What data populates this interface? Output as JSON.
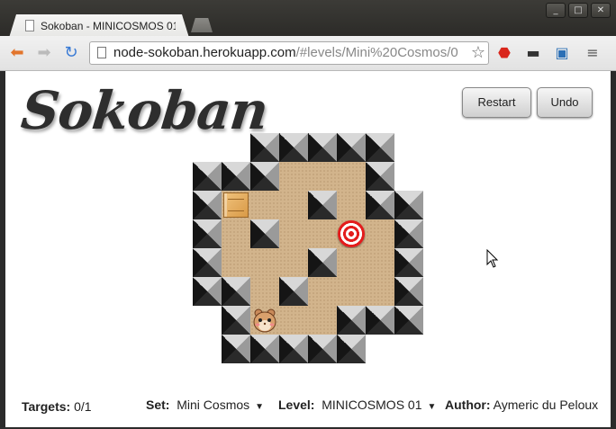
{
  "browser": {
    "tab_title": "Sokoban - MINICOSMOS 01",
    "url_host": "node-sokoban.herokuapp.com",
    "url_path": "/#levels/Mini%20Cosmos/0",
    "window_buttons": [
      "minimize-icon",
      "maximize-icon",
      "close-icon"
    ]
  },
  "page": {
    "logo": "Sokoban",
    "restart_label": "Restart",
    "undo_label": "Undo"
  },
  "level": {
    "grid": [
      "  #####",
      "###   #",
      "#$  # ##",
      "# #  . #",
      "#   #  #",
      "## #   #",
      " #@  ###",
      " #####"
    ],
    "legend": {
      "#": "wall",
      " ": "floor",
      "$": "box",
      ".": "target",
      "@": "player"
    },
    "colors": {
      "floor": "#d2b48c",
      "target": "#e31c1c",
      "box": "#e0a553"
    }
  },
  "footer": {
    "targets_label": "Targets:",
    "targets_value": "0/1",
    "set_label": "Set:",
    "set_value": "Mini Cosmos",
    "level_label": "Level:",
    "level_value": "MINICOSMOS 01",
    "author_label": "Author:",
    "author_value": "Aymeric du Peloux"
  }
}
